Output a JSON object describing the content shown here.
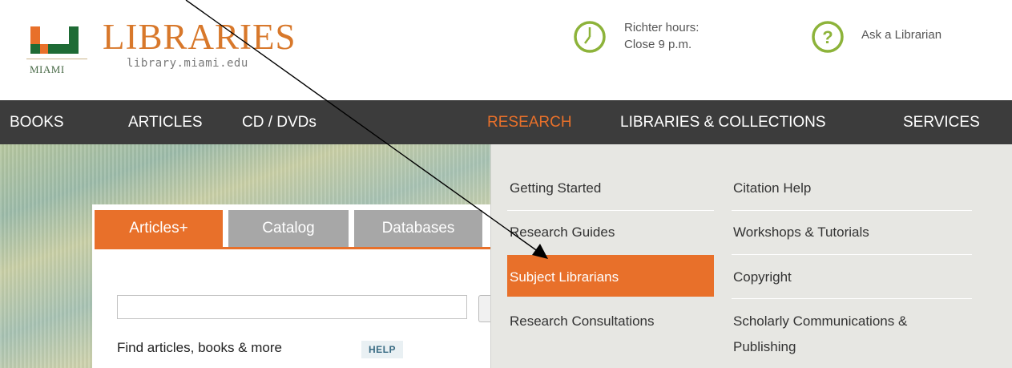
{
  "header": {
    "logo_title": "LIBRARIES",
    "logo_url": "library.miami.edu",
    "logo_wordmark": "MIAMI",
    "hours_line1": "Richter hours:",
    "hours_line2": "Close 9 p.m.",
    "ask_label": "Ask a Librarian"
  },
  "nav": {
    "items": [
      "BOOKS",
      "ARTICLES",
      "CD / DVDs",
      "RESEARCH",
      "LIBRARIES & COLLECTIONS",
      "SERVICES"
    ],
    "active": "RESEARCH"
  },
  "search": {
    "tabs": [
      "Articles+",
      "Catalog",
      "Databases"
    ],
    "active_tab": "Articles+",
    "input_value": "",
    "find_label": "Find articles, books & more",
    "help_label": "HELP"
  },
  "dropdown": {
    "left": [
      "Getting Started",
      "Research Guides",
      "Subject Librarians",
      "Research Consultations"
    ],
    "right": [
      "Citation Help",
      "Workshops & Tutorials",
      "Copyright",
      "Scholarly Communications &",
      "Publishing"
    ],
    "highlighted": "Subject Librarians"
  },
  "colors": {
    "accent": "#e8702a",
    "nav_bg": "#3c3c3c",
    "logo_green": "#1e6b35",
    "icon_green": "#8db33a"
  },
  "icons": {
    "hours": "clock-icon",
    "ask": "question-icon",
    "logo": "u-logo-icon"
  }
}
